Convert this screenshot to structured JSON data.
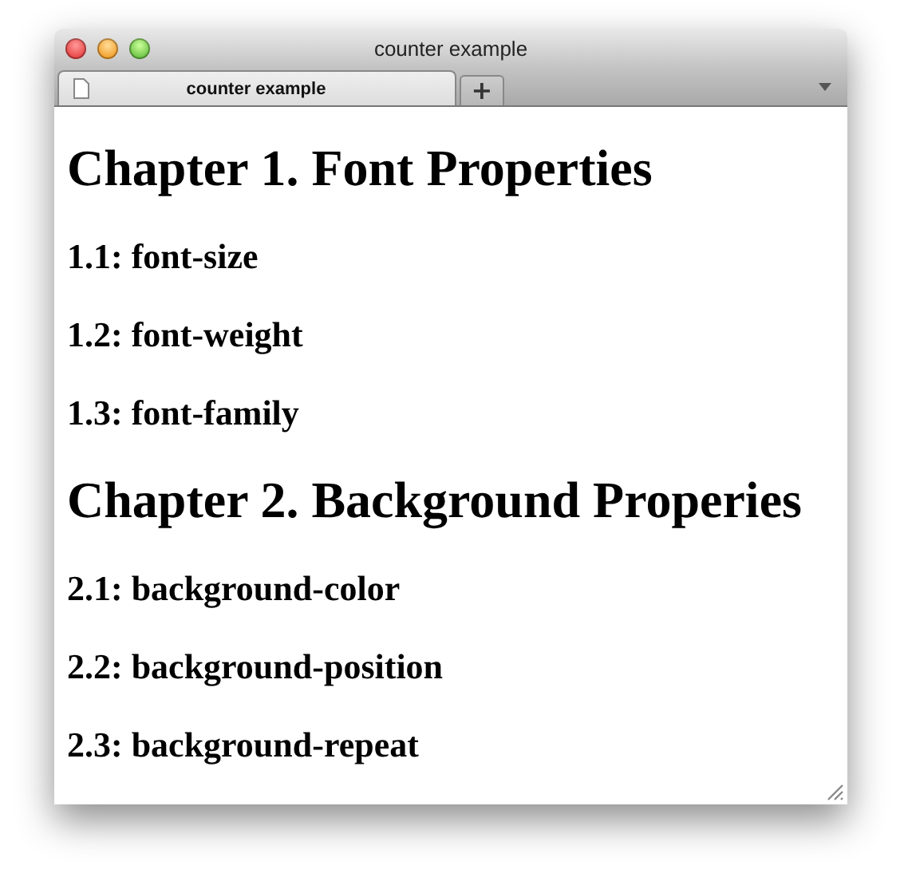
{
  "window": {
    "title": "counter example"
  },
  "tabs": [
    {
      "label": "counter example",
      "selected": true
    }
  ],
  "new_tab_button": {
    "label": "+"
  },
  "headings": [
    {
      "kind": "chapter",
      "text": "Chapter 1. Font Properties"
    },
    {
      "kind": "section",
      "text": "1.1: font-size"
    },
    {
      "kind": "section",
      "text": "1.2: font-weight"
    },
    {
      "kind": "section",
      "text": "1.3: font-family"
    },
    {
      "kind": "chapter",
      "text": "Chapter 2. Background Properies"
    },
    {
      "kind": "section",
      "text": "2.1: background-color"
    },
    {
      "kind": "section",
      "text": "2.2: background-position"
    },
    {
      "kind": "section",
      "text": "2.3: background-repeat"
    }
  ]
}
